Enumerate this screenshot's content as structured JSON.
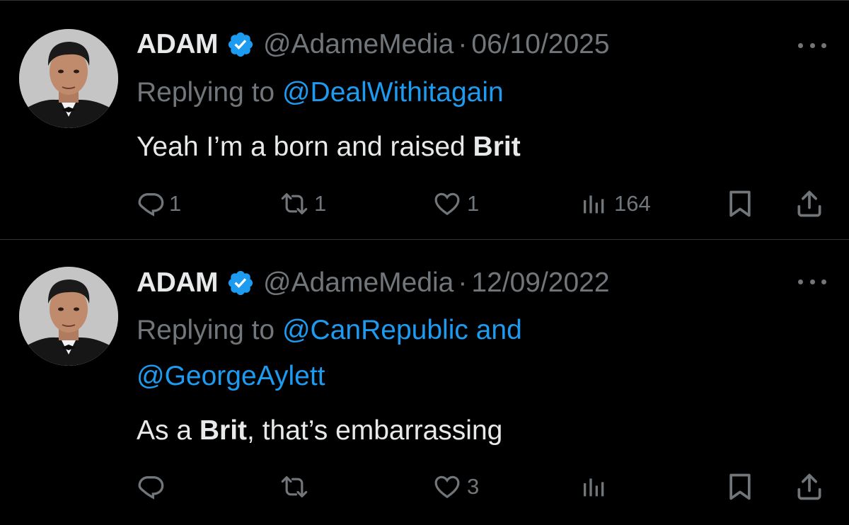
{
  "tweets": [
    {
      "name": "ADAM",
      "handle": "@AdameMedia",
      "separator": "·",
      "date": "06/10/2025",
      "replying_prefix": "Replying to",
      "replying_mentions_line1": "@DealWithitagain",
      "replying_mentions_line2": "",
      "text_before": "Yeah I’m a born and raised ",
      "text_bold": "Brit",
      "text_after": "",
      "replies": "1",
      "reposts": "1",
      "likes": "1",
      "views": "164"
    },
    {
      "name": "ADAM",
      "handle": "@AdameMedia",
      "separator": "·",
      "date": "12/09/2022",
      "replying_prefix": "Replying to",
      "replying_mentions_line1": "@CanRepublic and",
      "replying_mentions_line2": "@GeorgeAylett",
      "text_before": "As a ",
      "text_bold": "Brit",
      "text_after": ", that’s embarrassing",
      "replies": "",
      "reposts": "",
      "likes": "3",
      "views": ""
    }
  ],
  "icons": {
    "verified": "verified-badge-icon",
    "reply": "speech-bubble-icon",
    "repost": "repost-arrows-icon",
    "like": "heart-icon",
    "views": "bar-chart-icon",
    "bookmark": "bookmark-icon",
    "share": "share-upload-icon",
    "more": "ellipsis-icon"
  },
  "colors": {
    "background": "#000000",
    "text_primary": "#e7e9ea",
    "text_secondary": "#71767b",
    "accent": "#1d9bf0",
    "divider": "#2f3336"
  }
}
